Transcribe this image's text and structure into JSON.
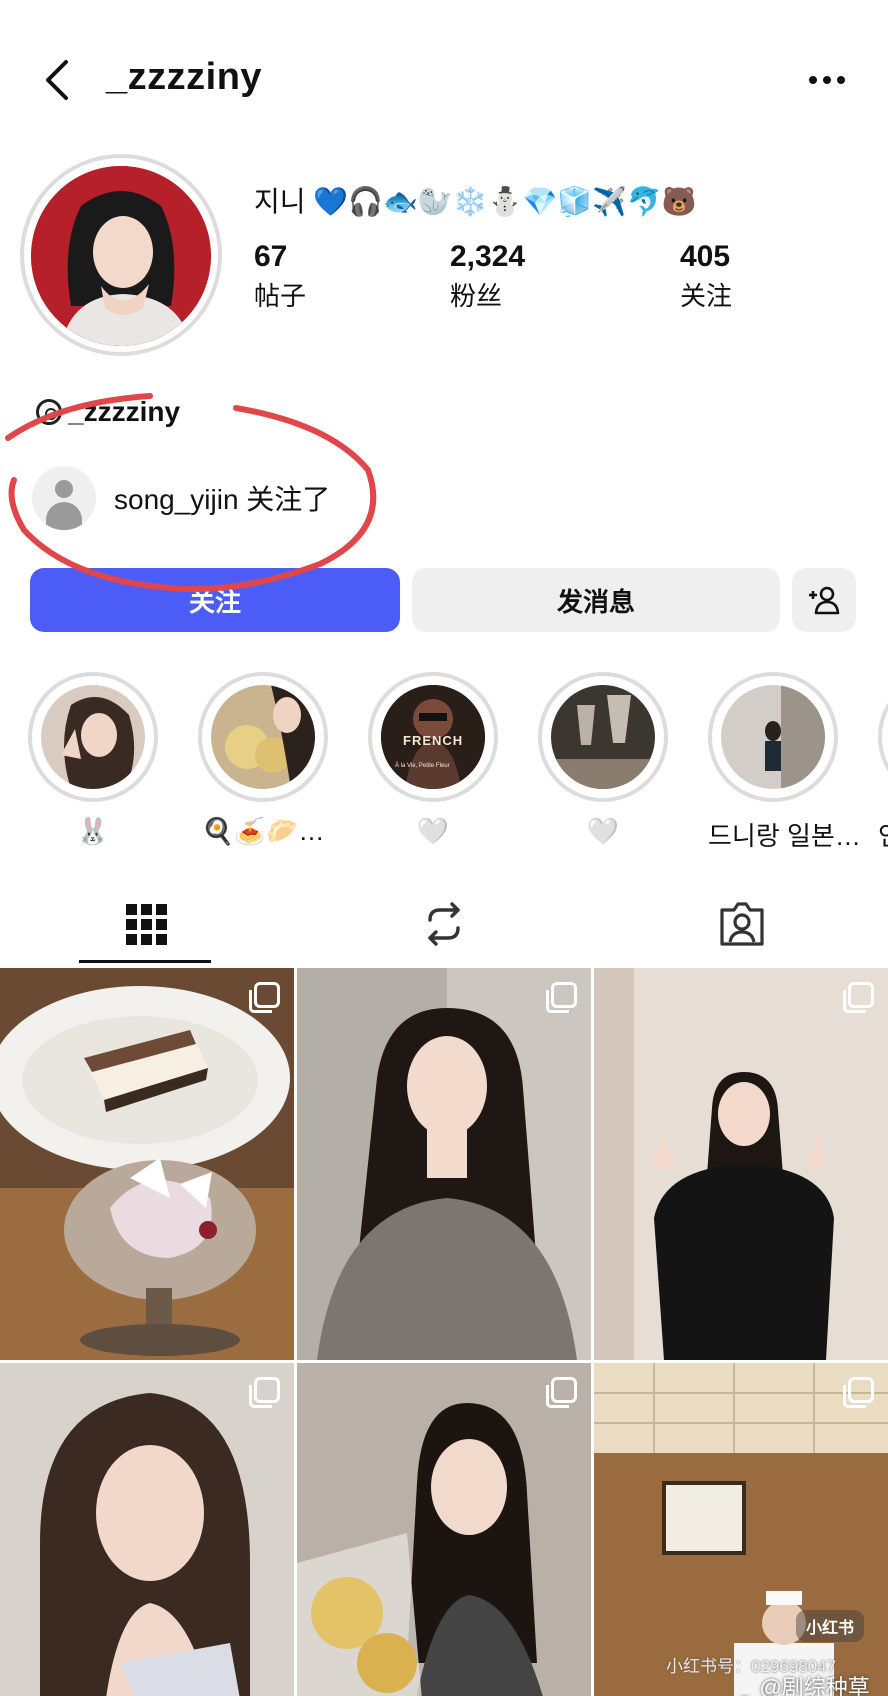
{
  "header": {
    "username": "_zzzziny"
  },
  "profile": {
    "display_name": "지니 💙🎧🐟🦭❄️⛄💎🧊✈️🐬🐻",
    "stats": [
      {
        "value": "67",
        "label": "帖子"
      },
      {
        "value": "2,324",
        "label": "粉丝"
      },
      {
        "value": "405",
        "label": "关注"
      }
    ],
    "threads_handle": "_zzzziny",
    "mutual_text": "song_yijin 关注了"
  },
  "buttons": {
    "follow": "关注",
    "message": "发消息"
  },
  "highlights": [
    {
      "label": "🐰"
    },
    {
      "label": "🍳🍝🥟…"
    },
    {
      "label": "🤍"
    },
    {
      "label": "🤍"
    },
    {
      "label": "드니랑 일본…"
    },
    {
      "label": "인"
    }
  ],
  "highlight_inner_text": {
    "french_title": "FRENCH",
    "french_caption": "À la Vie, Petite Fleur"
  },
  "tabs": [
    {
      "name": "posts",
      "icon": "grid-icon"
    },
    {
      "name": "reels",
      "icon": "repost-icon"
    },
    {
      "name": "tagged",
      "icon": "tagged-person-icon"
    }
  ],
  "watermark": {
    "badge": "小红书",
    "id": "小红书号：029698047",
    "weibo": "@剧综种草机"
  },
  "colors": {
    "follow_blue": "#4b5df6",
    "annotation_red": "#e0474b",
    "secondary_button": "#efefef"
  }
}
